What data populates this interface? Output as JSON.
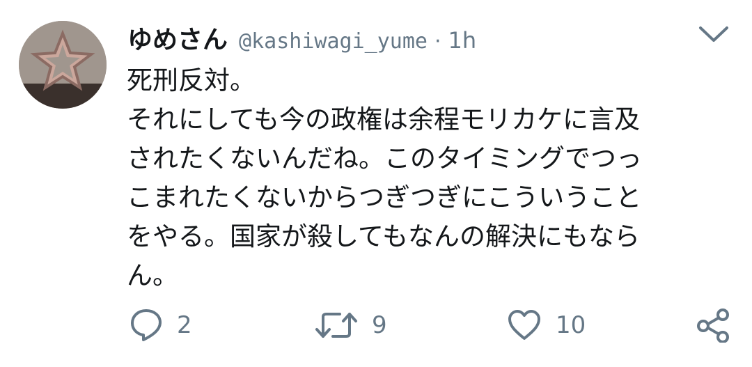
{
  "tweet": {
    "display_name": "ゆめさん",
    "handle": "@kashiwagi_yume",
    "separator": "·",
    "time": "1h",
    "body_lines": [
      "死刑反対。",
      "それにしても今の政権は余程モリカケに言及",
      "されたくないんだね。このタイミングでつっ",
      "こまれたくないからつぎつぎにこういうこと",
      "をやる。国家が殺してもなんの解決にもなら",
      "ん。"
    ]
  },
  "actions": {
    "reply_count": "2",
    "retweet_count": "9",
    "like_count": "10"
  },
  "icons": {
    "menu": "chevron-down-icon",
    "reply": "reply-icon",
    "retweet": "retweet-icon",
    "like": "heart-icon",
    "share": "share-icon"
  },
  "colors": {
    "text": "#14171a",
    "secondary": "#657786",
    "background": "#ffffff"
  }
}
